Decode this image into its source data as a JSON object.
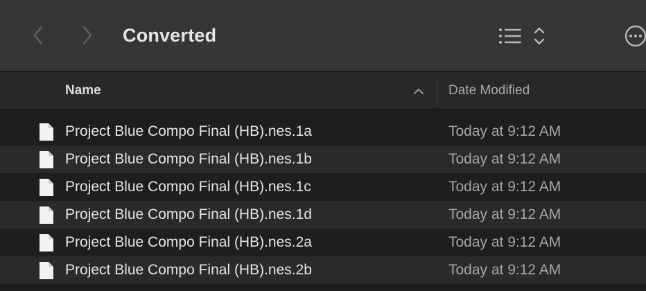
{
  "toolbar": {
    "title": "Converted",
    "back_icon": "chevron-left-icon",
    "forward_icon": "chevron-right-icon",
    "view_icon": "list-view-icon",
    "more_icon": "ellipsis-circle-icon"
  },
  "header": {
    "name_label": "Name",
    "date_label": "Date Modified",
    "sort_direction": "ascending"
  },
  "files": [
    {
      "name": "Project Blue Compo Final (HB).nes.1a",
      "date": "Today at 9:12 AM"
    },
    {
      "name": "Project Blue Compo Final (HB).nes.1b",
      "date": "Today at 9:12 AM"
    },
    {
      "name": "Project Blue Compo Final (HB).nes.1c",
      "date": "Today at 9:12 AM"
    },
    {
      "name": "Project Blue Compo Final (HB).nes.1d",
      "date": "Today at 9:12 AM"
    },
    {
      "name": "Project Blue Compo Final (HB).nes.2a",
      "date": "Today at 9:12 AM"
    },
    {
      "name": "Project Blue Compo Final (HB).nes.2b",
      "date": "Today at 9:12 AM"
    }
  ],
  "colors": {
    "toolbar_bg": "#363636",
    "list_bg": "#1e1e1e",
    "row_alt_bg": "#2a2a2a",
    "text_primary": "#e4e4e4",
    "text_secondary": "#a6a6a6"
  }
}
